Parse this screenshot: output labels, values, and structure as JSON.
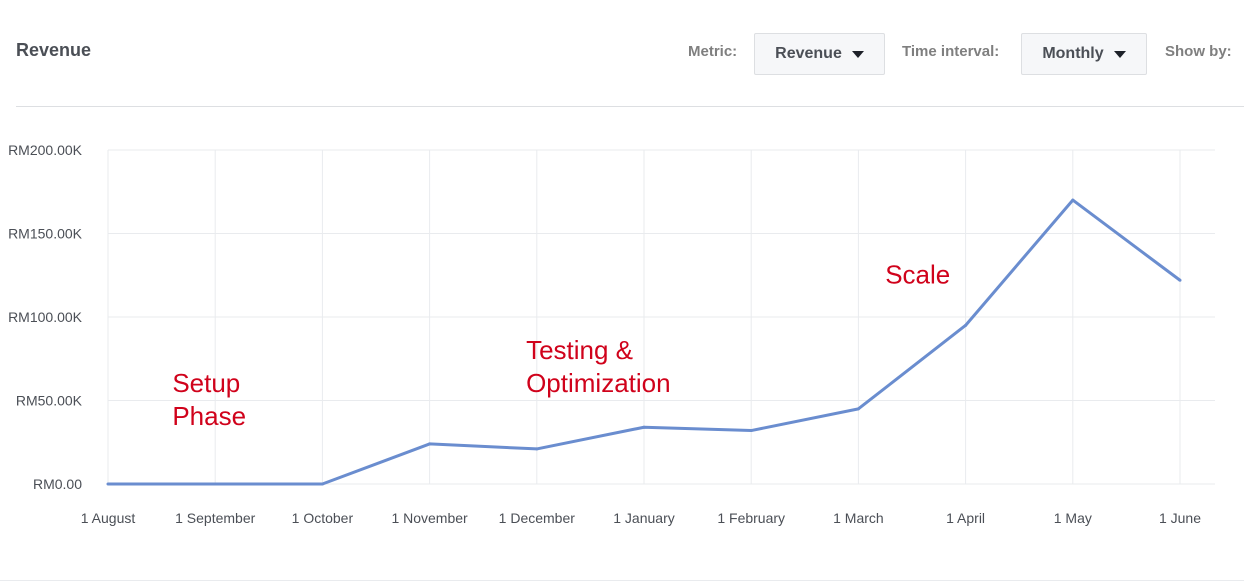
{
  "header": {
    "title": "Revenue",
    "metric_label": "Metric:",
    "metric_value": "Revenue",
    "interval_label": "Time interval:",
    "interval_value": "Monthly",
    "show_by_label": "Show by:"
  },
  "colors": {
    "line": "#6a8dcf",
    "annotation": "#d0021b",
    "grid": "#e9ebee"
  },
  "chart_data": {
    "type": "line",
    "title": "Revenue",
    "xlabel": "",
    "ylabel": "",
    "categories": [
      "1 August",
      "1 September",
      "1 October",
      "1 November",
      "1 December",
      "1 January",
      "1 February",
      "1 March",
      "1 April",
      "1 May",
      "1 June"
    ],
    "series": [
      {
        "values": [
          0,
          0,
          0,
          24000,
          21000,
          34000,
          32000,
          45000,
          95000,
          170000,
          122000
        ]
      }
    ],
    "ylim": [
      0,
      200000
    ],
    "y_ticks": [
      {
        "value": 0,
        "label": "RM0.00"
      },
      {
        "value": 50000,
        "label": "RM50.00K"
      },
      {
        "value": 100000,
        "label": "RM100.00K"
      },
      {
        "value": 150000,
        "label": "RM150.00K"
      },
      {
        "value": 200000,
        "label": "RM200.00K"
      }
    ],
    "grid": true,
    "annotations": [
      {
        "lines": [
          "Setup",
          "Phase"
        ],
        "x_index": 0.6,
        "y_value": 55000
      },
      {
        "lines": [
          "Testing &",
          "Optimization"
        ],
        "x_index": 3.9,
        "y_value": 75000
      },
      {
        "lines": [
          "Scale"
        ],
        "x_index": 7.25,
        "y_value": 120000
      }
    ]
  }
}
